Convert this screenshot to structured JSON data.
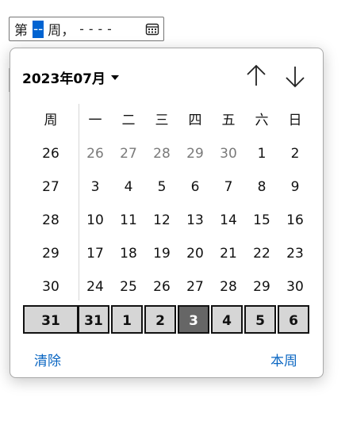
{
  "week_input": {
    "prefix": "第",
    "week_placeholder": "--",
    "middle": "周，",
    "year_placeholder": "----"
  },
  "picker": {
    "month_label": "2023年07月",
    "weekday_headers": [
      "周",
      "一",
      "二",
      "三",
      "四",
      "五",
      "六",
      "日"
    ],
    "weeks": [
      {
        "week": "26",
        "days": [
          "26",
          "27",
          "28",
          "29",
          "30",
          "1",
          "2"
        ],
        "muted": [
          true,
          true,
          true,
          true,
          true,
          false,
          false
        ]
      },
      {
        "week": "27",
        "days": [
          "3",
          "4",
          "5",
          "6",
          "7",
          "8",
          "9"
        ],
        "muted": [
          false,
          false,
          false,
          false,
          false,
          false,
          false
        ]
      },
      {
        "week": "28",
        "days": [
          "10",
          "11",
          "12",
          "13",
          "14",
          "15",
          "16"
        ],
        "muted": [
          false,
          false,
          false,
          false,
          false,
          false,
          false
        ]
      },
      {
        "week": "29",
        "days": [
          "17",
          "18",
          "19",
          "20",
          "21",
          "22",
          "23"
        ],
        "muted": [
          false,
          false,
          false,
          false,
          false,
          false,
          false
        ]
      },
      {
        "week": "30",
        "days": [
          "24",
          "25",
          "26",
          "27",
          "28",
          "29",
          "30"
        ],
        "muted": [
          false,
          false,
          false,
          false,
          false,
          false,
          false
        ]
      },
      {
        "week": "31",
        "days": [
          "31",
          "1",
          "2",
          "3",
          "4",
          "5",
          "6"
        ],
        "muted": [
          false,
          false,
          false,
          false,
          false,
          false,
          false
        ],
        "selected": true,
        "today_index": 3
      }
    ],
    "clear_label": "清除",
    "this_week_label": "本周"
  },
  "colors": {
    "accent": "#0063d1",
    "link": "#0a66c2",
    "selected_bg": "#d6d6d6",
    "today_bg": "#666666"
  },
  "icons": {
    "calendar": "calendar-icon",
    "month_dropdown": "caret-down-icon",
    "prev": "arrow-up-icon",
    "next": "arrow-down-icon"
  }
}
